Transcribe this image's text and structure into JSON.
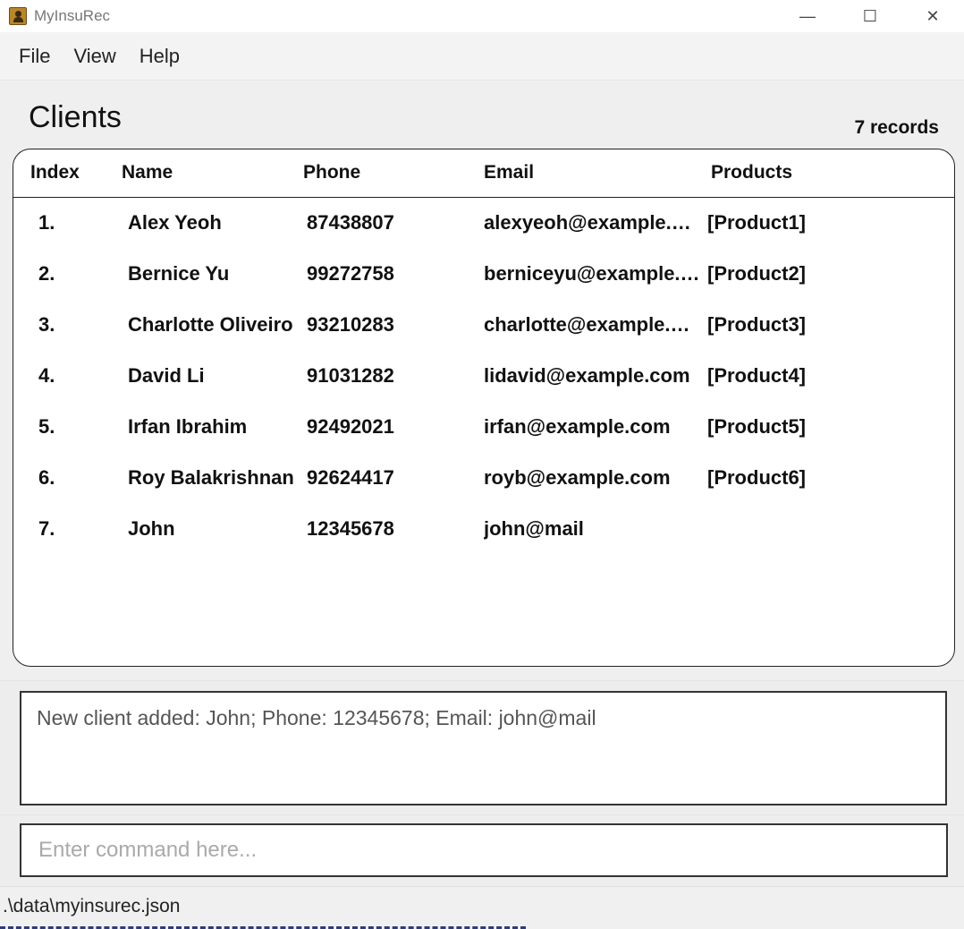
{
  "window": {
    "title": "MyInsuRec",
    "minimize_glyph": "—",
    "maximize_glyph": "☐",
    "close_glyph": "✕"
  },
  "menu": {
    "items": [
      {
        "label": "File"
      },
      {
        "label": "View"
      },
      {
        "label": "Help"
      }
    ]
  },
  "clients": {
    "title": "Clients",
    "record_count": "7 records",
    "columns": {
      "index": "Index",
      "name": "Name",
      "phone": "Phone",
      "email": "Email",
      "products": "Products"
    },
    "rows": [
      {
        "index": "1.",
        "name": "Alex Yeoh",
        "phone": "87438807",
        "email": "alexyeoh@example.…",
        "products": "[Product1]"
      },
      {
        "index": "2.",
        "name": "Bernice Yu",
        "phone": "99272758",
        "email": "berniceyu@example.…",
        "products": "[Product2]"
      },
      {
        "index": "3.",
        "name": "Charlotte Oliveiro",
        "phone": "93210283",
        "email": "charlotte@example.…",
        "products": "[Product3]"
      },
      {
        "index": "4.",
        "name": "David Li",
        "phone": "91031282",
        "email": "lidavid@example.com",
        "products": "[Product4]"
      },
      {
        "index": "5.",
        "name": "Irfan Ibrahim",
        "phone": "92492021",
        "email": "irfan@example.com",
        "products": "[Product5]"
      },
      {
        "index": "6.",
        "name": "Roy Balakrishnan",
        "phone": "92624417",
        "email": "royb@example.com",
        "products": "[Product6]"
      },
      {
        "index": "7.",
        "name": "John",
        "phone": "12345678",
        "email": "john@mail",
        "products": ""
      }
    ]
  },
  "result": {
    "message": "New client added: John; Phone: 12345678; Email: john@mail"
  },
  "command": {
    "value": "",
    "placeholder": "Enter command here..."
  },
  "status": {
    "file_path": ".\\data\\myinsurec.json"
  }
}
